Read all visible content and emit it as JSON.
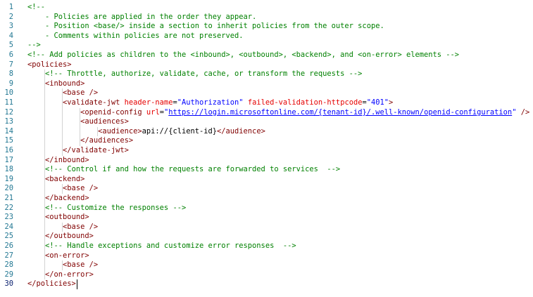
{
  "editor": {
    "active_line": "30",
    "lines": [
      {
        "n": "1",
        "tokens": [
          {
            "t": "<!--",
            "c": "cm"
          }
        ]
      },
      {
        "n": "2",
        "tokens": [
          {
            "t": "    - Policies are applied in the order they appear.",
            "c": "cm"
          }
        ]
      },
      {
        "n": "3",
        "tokens": [
          {
            "t": "    - Position <base/> inside a section to inherit policies from the outer scope.",
            "c": "cm"
          }
        ]
      },
      {
        "n": "4",
        "tokens": [
          {
            "t": "    - Comments within policies are not preserved.",
            "c": "cm"
          }
        ]
      },
      {
        "n": "5",
        "tokens": [
          {
            "t": "-->",
            "c": "cm"
          }
        ]
      },
      {
        "n": "6",
        "tokens": [
          {
            "t": "<!-- Add policies as children to the <inbound>, <outbound>, <backend>, and <on-error> elements -->",
            "c": "cm"
          }
        ]
      },
      {
        "n": "7",
        "tokens": [
          {
            "t": "<policies>",
            "c": "tg"
          }
        ]
      },
      {
        "n": "8",
        "tokens": [
          {
            "t": "    ",
            "c": "tx"
          },
          {
            "t": "<!-- Throttle, authorize, validate, cache, or transform the requests -->",
            "c": "cm"
          }
        ]
      },
      {
        "n": "9",
        "tokens": [
          {
            "t": "    ",
            "c": "tx"
          },
          {
            "t": "<inbound>",
            "c": "tg"
          }
        ]
      },
      {
        "n": "10",
        "tokens": [
          {
            "t": "        ",
            "c": "tx"
          },
          {
            "t": "<base />",
            "c": "tg"
          }
        ]
      },
      {
        "n": "11",
        "tokens": [
          {
            "t": "        ",
            "c": "tx"
          },
          {
            "t": "<validate-jwt",
            "c": "tg"
          },
          {
            "t": " header-name",
            "c": "at"
          },
          {
            "t": "=",
            "c": "eq"
          },
          {
            "t": "\"Authorization\"",
            "c": "st"
          },
          {
            "t": " failed-validation-httpcode",
            "c": "at"
          },
          {
            "t": "=",
            "c": "eq"
          },
          {
            "t": "\"401\"",
            "c": "st"
          },
          {
            "t": ">",
            "c": "tg"
          }
        ]
      },
      {
        "n": "12",
        "tokens": [
          {
            "t": "            ",
            "c": "tx"
          },
          {
            "t": "<openid-config",
            "c": "tg"
          },
          {
            "t": " url",
            "c": "at"
          },
          {
            "t": "=",
            "c": "eq"
          },
          {
            "t": "\"",
            "c": "st"
          },
          {
            "t": "https://login.microsoftonline.com/{tenant-id}/.well-known/openid-configuration",
            "c": "st ul"
          },
          {
            "t": "\"",
            "c": "st"
          },
          {
            "t": " />",
            "c": "tg"
          }
        ]
      },
      {
        "n": "13",
        "tokens": [
          {
            "t": "            ",
            "c": "tx"
          },
          {
            "t": "<audiences>",
            "c": "tg"
          }
        ]
      },
      {
        "n": "14",
        "tokens": [
          {
            "t": "                ",
            "c": "tx"
          },
          {
            "t": "<audience>",
            "c": "tg"
          },
          {
            "t": "api://{client-id}",
            "c": "tx"
          },
          {
            "t": "</audience>",
            "c": "tg"
          }
        ]
      },
      {
        "n": "15",
        "tokens": [
          {
            "t": "            ",
            "c": "tx"
          },
          {
            "t": "</audiences>",
            "c": "tg"
          }
        ]
      },
      {
        "n": "16",
        "tokens": [
          {
            "t": "        ",
            "c": "tx"
          },
          {
            "t": "</validate-jwt>",
            "c": "tg"
          }
        ]
      },
      {
        "n": "17",
        "tokens": [
          {
            "t": "    ",
            "c": "tx"
          },
          {
            "t": "</inbound>",
            "c": "tg"
          }
        ]
      },
      {
        "n": "18",
        "tokens": [
          {
            "t": "    ",
            "c": "tx"
          },
          {
            "t": "<!-- Control if and how the requests are forwarded to services  -->",
            "c": "cm"
          }
        ]
      },
      {
        "n": "19",
        "tokens": [
          {
            "t": "    ",
            "c": "tx"
          },
          {
            "t": "<backend>",
            "c": "tg"
          }
        ]
      },
      {
        "n": "20",
        "tokens": [
          {
            "t": "        ",
            "c": "tx"
          },
          {
            "t": "<base />",
            "c": "tg"
          }
        ]
      },
      {
        "n": "21",
        "tokens": [
          {
            "t": "    ",
            "c": "tx"
          },
          {
            "t": "</backend>",
            "c": "tg"
          }
        ]
      },
      {
        "n": "22",
        "tokens": [
          {
            "t": "    ",
            "c": "tx"
          },
          {
            "t": "<!-- Customize the responses -->",
            "c": "cm"
          }
        ]
      },
      {
        "n": "23",
        "tokens": [
          {
            "t": "    ",
            "c": "tx"
          },
          {
            "t": "<outbound>",
            "c": "tg"
          }
        ]
      },
      {
        "n": "24",
        "tokens": [
          {
            "t": "        ",
            "c": "tx"
          },
          {
            "t": "<base />",
            "c": "tg"
          }
        ]
      },
      {
        "n": "25",
        "tokens": [
          {
            "t": "    ",
            "c": "tx"
          },
          {
            "t": "</outbound>",
            "c": "tg"
          }
        ]
      },
      {
        "n": "26",
        "tokens": [
          {
            "t": "    ",
            "c": "tx"
          },
          {
            "t": "<!-- Handle exceptions and customize error responses  -->",
            "c": "cm"
          }
        ]
      },
      {
        "n": "27",
        "tokens": [
          {
            "t": "    ",
            "c": "tx"
          },
          {
            "t": "<on-error>",
            "c": "tg"
          }
        ]
      },
      {
        "n": "28",
        "tokens": [
          {
            "t": "        ",
            "c": "tx"
          },
          {
            "t": "<base />",
            "c": "tg"
          }
        ]
      },
      {
        "n": "29",
        "tokens": [
          {
            "t": "    ",
            "c": "tx"
          },
          {
            "t": "</on-error>",
            "c": "tg"
          }
        ]
      },
      {
        "n": "30",
        "tokens": [
          {
            "t": "</policies>",
            "c": "tg"
          }
        ]
      }
    ]
  },
  "theme": {
    "background": "#ffffff",
    "line_number": "#237893",
    "active_line_number": "#0b216f",
    "comment": "#008000",
    "tag": "#800000",
    "attribute": "#e50000",
    "string": "#0000ff",
    "text": "#000000",
    "indent_guide": "#d3d3d3"
  }
}
